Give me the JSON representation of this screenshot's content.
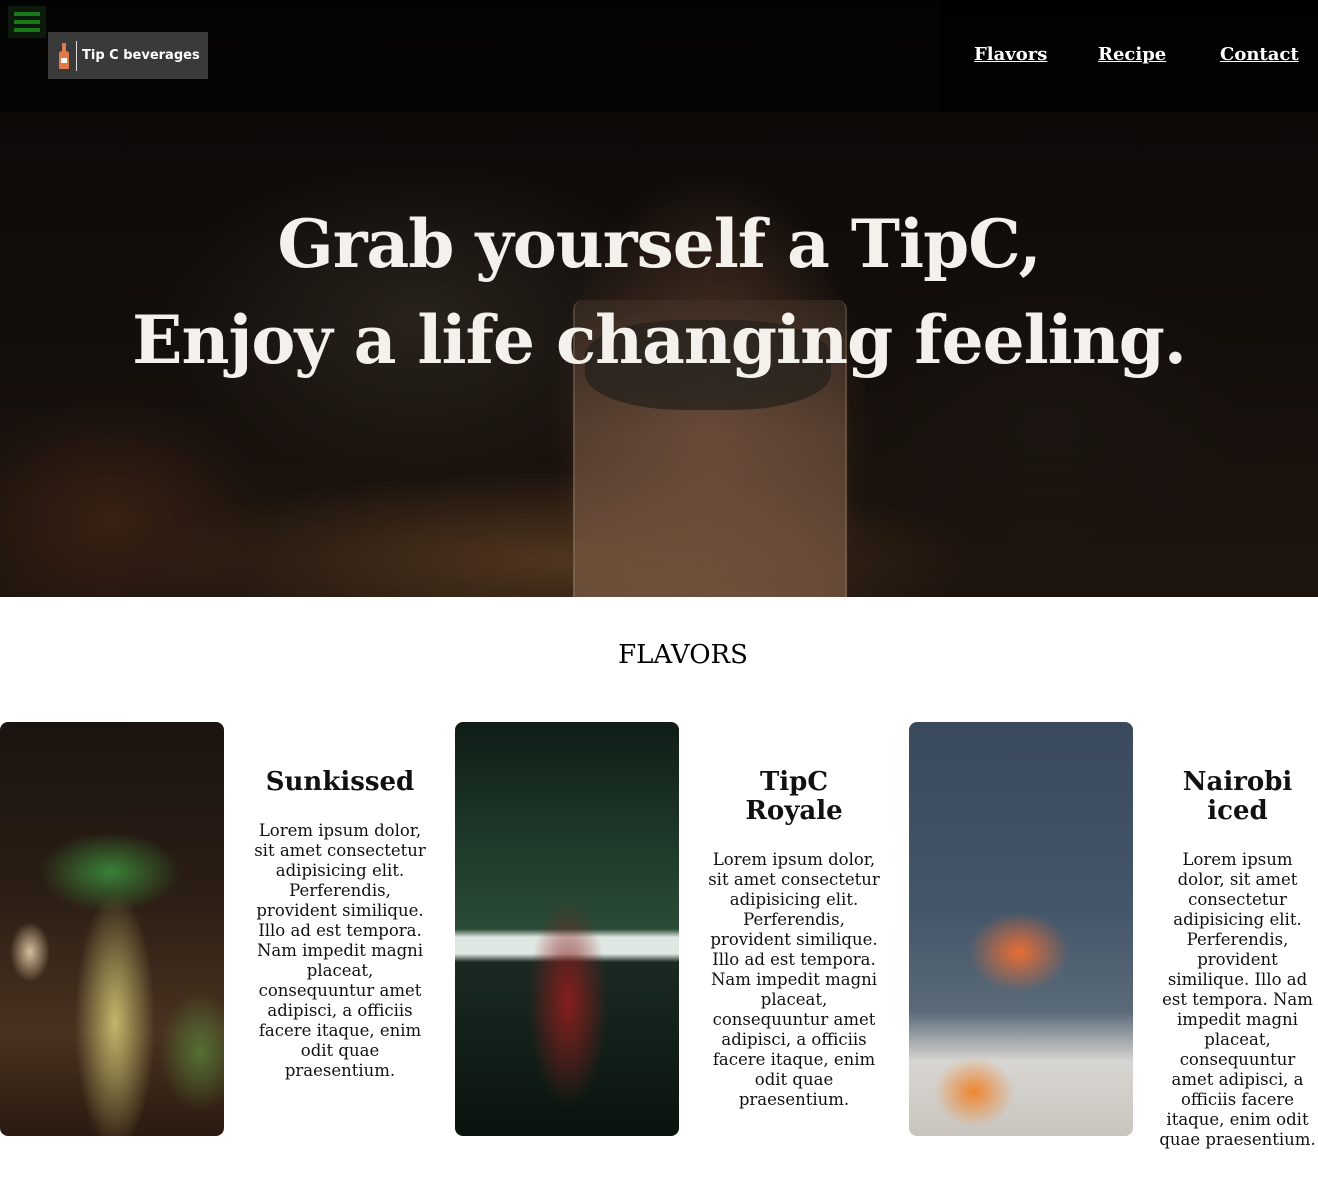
{
  "brand": {
    "name": "Tip C beverages",
    "menu_icon": "hamburger-icon",
    "logo_icon": "bottle-icon"
  },
  "nav": {
    "items": [
      {
        "label": "Flavors"
      },
      {
        "label": "Recipe"
      },
      {
        "label": "Contact"
      }
    ]
  },
  "hero": {
    "line1": "Grab yourself a TipC,",
    "line2": "Enjoy a life changing feeling."
  },
  "flavors": {
    "title": "FLAVORS",
    "items": [
      {
        "name": "Sunkissed",
        "description": "Lorem ipsum dolor, sit amet consectetur adipisicing elit. Perferendis, provident similique. Illo ad est tempora. Nam impedit magni placeat, consequuntur amet adipisci, a officiis facere itaque, enim odit quae praesentium."
      },
      {
        "name": "TipC Royale",
        "description": "Lorem ipsum dolor, sit amet consectetur adipisicing elit. Perferendis, provident similique. Illo ad est tempora. Nam impedit magni placeat, consequuntur amet adipisci, a officiis facere itaque, enim odit quae praesentium."
      },
      {
        "name": "Nairobi iced",
        "description": "Lorem ipsum dolor, sit amet consectetur adipisicing elit. Perferendis, provident similique. Illo ad est tempora. Nam impedit magni placeat, consequuntur amet adipisci, a officiis facere itaque, enim odit quae praesentium."
      }
    ]
  },
  "colors": {
    "menu_icon": "#1a7a1a",
    "logo_bg": "#3a3a3a",
    "nav_text": "#ffffff",
    "hero_text": "#f4f1ec"
  }
}
